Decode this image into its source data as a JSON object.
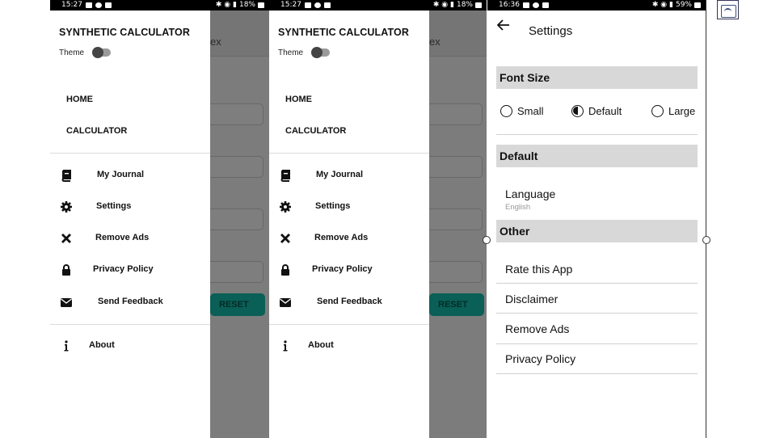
{
  "phone1": {
    "status_time": "15:27",
    "status_battery": "18%",
    "bg_header_text": "ex",
    "bg_reset_label": "RESET",
    "drawer": {
      "title": "SYNTHETIC CALCULATOR",
      "theme_label": "Theme",
      "nav_home": "HOME",
      "nav_calculator": "CALCULATOR",
      "items": [
        {
          "label": "My Journal",
          "icon": "book-icon"
        },
        {
          "label": "Settings",
          "icon": "gear-icon"
        },
        {
          "label": "Remove Ads",
          "icon": "close-icon"
        },
        {
          "label": "Privacy Policy",
          "icon": "lock-icon"
        },
        {
          "label": "Send Feedback",
          "icon": "envelope-icon"
        }
      ],
      "about_label": "About",
      "about_icon": "info-icon"
    }
  },
  "phone2": {
    "status_time": "15:27",
    "status_battery": "18%",
    "bg_header_text": "ex",
    "bg_reset_label": "RESET",
    "drawer": {
      "title": "SYNTHETIC CALCULATOR",
      "theme_label": "Theme",
      "nav_home": "HOME",
      "nav_calculator": "CALCULATOR",
      "items": [
        {
          "label": "My Journal",
          "icon": "book-icon"
        },
        {
          "label": "Settings",
          "icon": "gear-icon"
        },
        {
          "label": "Remove Ads",
          "icon": "close-icon"
        },
        {
          "label": "Privacy Policy",
          "icon": "lock-icon"
        },
        {
          "label": "Send Feedback",
          "icon": "envelope-icon"
        }
      ],
      "about_label": "About",
      "about_icon": "info-icon"
    }
  },
  "phone3": {
    "status_time": "16:36",
    "status_battery": "59%",
    "title": "Settings",
    "font_size": {
      "section_label": "Font Size",
      "options": [
        "Small",
        "Default",
        "Large"
      ],
      "selected": "Default"
    },
    "default_section": {
      "section_label": "Default",
      "language_label": "Language",
      "language_value": "English"
    },
    "other_section": {
      "section_label": "Other",
      "items": [
        "Rate this App",
        "Disclaimer",
        "Remove Ads",
        "Privacy Policy"
      ]
    }
  },
  "colors": {
    "reset_button": "#0a5f56",
    "scrim": "#7a7a7a",
    "section_bg": "#d8d8d8"
  }
}
